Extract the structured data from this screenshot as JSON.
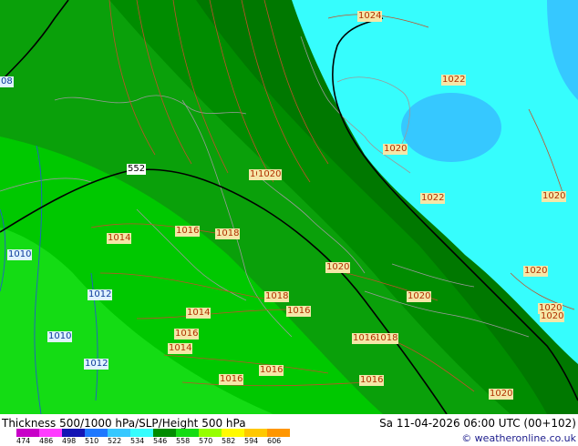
{
  "map": {
    "isobar_labels": [
      {
        "text": "1024",
        "style": "iso"
      },
      {
        "text": "1022",
        "style": "iso"
      },
      {
        "text": "1020",
        "style": "iso"
      },
      {
        "text": "1022",
        "style": "iso"
      },
      {
        "text": "1020",
        "style": "iso"
      },
      {
        "text": "1020",
        "style": "iso"
      },
      {
        "text": "1020",
        "style": "iso"
      },
      {
        "text": "1020",
        "style": "iso"
      },
      {
        "text": "1020",
        "style": "iso"
      },
      {
        "text": "1020",
        "style": "iso"
      },
      {
        "text": "1020",
        "style": "iso"
      },
      {
        "text": "1020",
        "style": "iso"
      },
      {
        "text": "1020",
        "style": "iso"
      },
      {
        "text": "1016",
        "style": "iso"
      },
      {
        "text": "1018",
        "style": "iso"
      },
      {
        "text": "1014",
        "style": "iso"
      },
      {
        "text": "1018",
        "style": "iso"
      },
      {
        "text": "1016",
        "style": "iso"
      },
      {
        "text": "1014",
        "style": "iso"
      },
      {
        "text": "1016",
        "style": "iso"
      },
      {
        "text": "1014",
        "style": "iso"
      },
      {
        "text": "1016",
        "style": "iso"
      },
      {
        "text": "1018",
        "style": "iso"
      },
      {
        "text": "1016",
        "style": "iso"
      },
      {
        "text": "1016",
        "style": "iso"
      },
      {
        "text": "1016",
        "style": "iso"
      },
      {
        "text": "1010",
        "style": "blue"
      },
      {
        "text": "1012",
        "style": "blue"
      },
      {
        "text": "1010",
        "style": "blue"
      },
      {
        "text": "1012",
        "style": "blue"
      },
      {
        "text": "08",
        "style": "blue"
      },
      {
        "text": "552",
        "style": "black"
      }
    ],
    "colors": {
      "t546": "#0aa00a",
      "t552": "#008c00",
      "t558": "#007800",
      "t540": "#00c800",
      "t534": "#14dc14",
      "warm_sea": "#36fdfd",
      "cold_core": "#36c8ff"
    }
  },
  "footer": {
    "title": "Thickness 500/1000 hPa/SLP/Height 500 hPa",
    "datetime": "Sa 11-04-2026 06:00 UTC (00+102)",
    "credit": "© weatheronline.co.uk"
  },
  "legend": {
    "swatches": [
      "#c800c8",
      "#ff3cff",
      "#1414b4",
      "#1e78ff",
      "#36c8ff",
      "#36fdfd",
      "#008c00",
      "#14dc14",
      "#96ff00",
      "#fffa00",
      "#ffc800",
      "#ff9600"
    ],
    "ticks": [
      "474",
      "486",
      "498",
      "510",
      "522",
      "534",
      "546",
      "558",
      "570",
      "582",
      "594",
      "606"
    ]
  }
}
